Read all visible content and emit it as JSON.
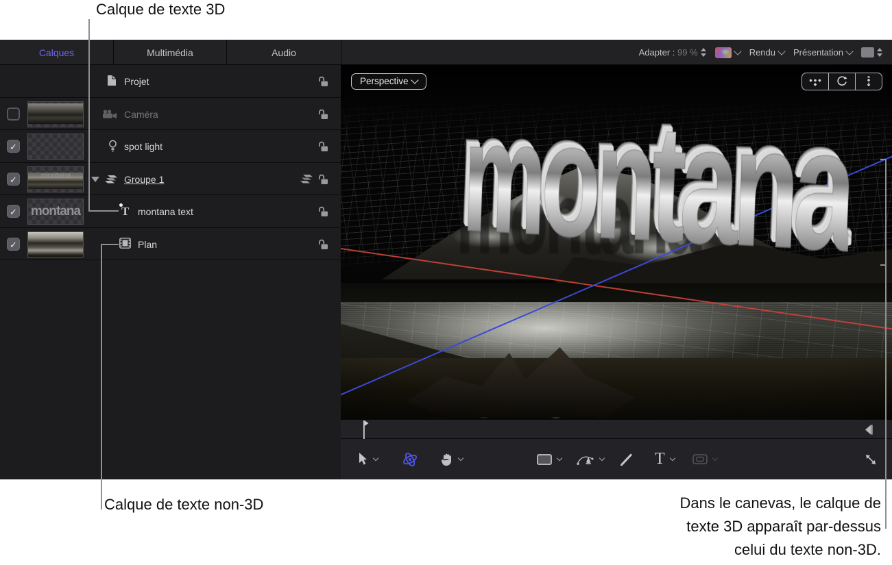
{
  "annotations": {
    "top": "Calque de texte 3D",
    "bottom_left": "Calque de texte non-3D",
    "bottom_right_line1": "Dans le canevas, le calque de",
    "bottom_right_line2": "texte 3D apparaît par-dessus",
    "bottom_right_line3": "celui du texte non-3D."
  },
  "tabs": {
    "calques": "Calques",
    "multimedia": "Multimédia",
    "audio": "Audio"
  },
  "header": {
    "adapter_label": "Adapter :",
    "zoom_value": "99 %",
    "render_label": "Rendu",
    "presentation_label": "Présentation"
  },
  "viewport": {
    "camera_menu_label": "Perspective",
    "text_3d": "montana"
  },
  "layers_panel": {
    "rows": [
      {
        "name": "Projet",
        "icon": "project-document-icon",
        "checkbox": "none",
        "locked": false
      },
      {
        "name": "Caméra",
        "icon": "camera-icon",
        "checkbox": "unchecked",
        "dimmed": true,
        "locked": false
      },
      {
        "name": "spot light",
        "icon": "light-icon",
        "checkbox": "checked",
        "locked": false
      },
      {
        "name": "Groupe 1",
        "icon": "group-layers-icon",
        "checkbox": "checked",
        "underlined": true,
        "locked": false
      },
      {
        "name": "montana text",
        "icon": "text-3d-icon",
        "checkbox": "checked",
        "indent": 1,
        "locked": false
      },
      {
        "name": "Plan",
        "icon": "film-layer-icon",
        "checkbox": "checked",
        "indent": 1,
        "locked": false
      }
    ],
    "thumb_text_label": "montana"
  },
  "tools": {
    "text_tool_glyph": "T"
  },
  "colors": {
    "accent_blue": "#5757e8",
    "tab_active_blue": "#6a66f2",
    "annotation_line_gray": "#8f8f8f",
    "guide_red": "#c5423a",
    "guide_blue": "#3a4ad6",
    "panel_bg": "#1d1d20",
    "chrome_bg": "#222225"
  }
}
